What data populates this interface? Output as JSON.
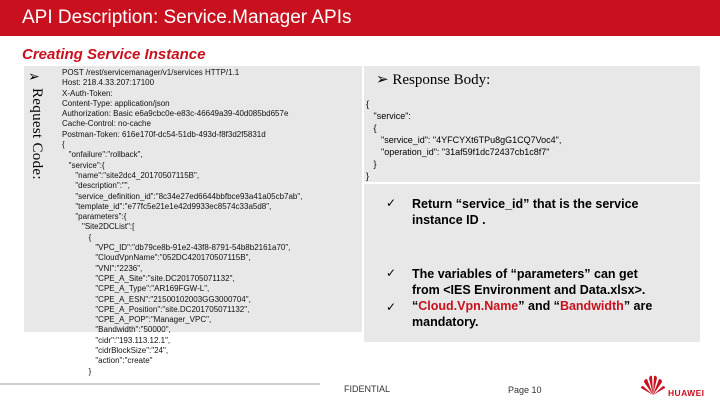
{
  "header": {
    "title": "API Description: Service.Manager APIs"
  },
  "section": {
    "title": "Creating Service Instance"
  },
  "request": {
    "side_label": "Request Code:",
    "lines": [
      "POST /rest/servicemanager/v1/services HTTP/1.1",
      "Host: 218.4.33.207:17100",
      "X-Auth-Token:",
      "Content-Type: application/json",
      "Authorization: Basic e6a9cbc0e-e83c-46649a39-40d085bd657e",
      "Cache-Control: no-cache",
      "Postman-Token: 616e170f-dc54-51db-493d-f8f3d2f5831d",
      "{",
      "   \"onfailure\":\"rollback\",",
      "   \"service\":{",
      "      \"name\":\"site2dc4_20170507115B\",",
      "      \"description\":\"\",",
      "      \"service_definition_id\":\"8c34e27ed6644bbfbce93a41a05cb7ab\",",
      "      \"template_id\":\"e77fc5e21e1e42d9933ec8574c33a5d8\",",
      "      \"parameters\":{",
      "         \"Site2DCList\":[",
      "            {",
      "               \"VPC_ID\":\"db79ce8b-91e2-43f8-8791-54b8b2161a70\",",
      "               \"CloudVpnName\":\"052DC420170507115B\",",
      "               \"VNI\":\"2236\",",
      "               \"CPE_A_Site\":\"site.DC201705071132\",",
      "               \"CPE_A_Type\":\"AR169FGW-L\",",
      "               \"CPE_A_ESN\":\"21500102003GG3000704\",",
      "               \"CPE_A_Position\":\"site.DC201705071132\",",
      "               \"CPE_A_POP\":\"Manager_VPC\",",
      "               \"Bandwidth\":\"50000\",",
      "               \"cidr\":\"193.113.12.1\",",
      "               \"cidrBlockSize\":\"24\",",
      "               \"action\":\"create\"",
      "            }"
    ]
  },
  "response": {
    "heading": "Response Body:",
    "lines": [
      "{",
      "   \"service\":",
      "   {",
      "      \"service_id\": \"4YFCYXt6TPu8gG1CQ7Voc4\",",
      "      \"operation_id\": \"31af59f1dc72437cb1c8f7\"",
      "   }",
      "}"
    ]
  },
  "bullets": {
    "b1_line1": "Return “service_id” that is the service",
    "b1_line2": "instance ID .",
    "b2_line1": "The variables of “parameters” can get",
    "b2_line2": "from <IES Environment and Data.xlsx>.",
    "b2_q1": "“",
    "b2_hl1": "Cloud.Vpn.Name",
    "b2_mid": "” and “",
    "b2_hl2": "Bandwidth",
    "b2_end": "” are",
    "b2_line4": "mandatory."
  },
  "footer": {
    "confidential": "FIDENTIAL",
    "page": "Page 10",
    "brand": "HUAWEI"
  },
  "colors": {
    "accent": "#c8101e",
    "panel": "#e8e8e8"
  }
}
